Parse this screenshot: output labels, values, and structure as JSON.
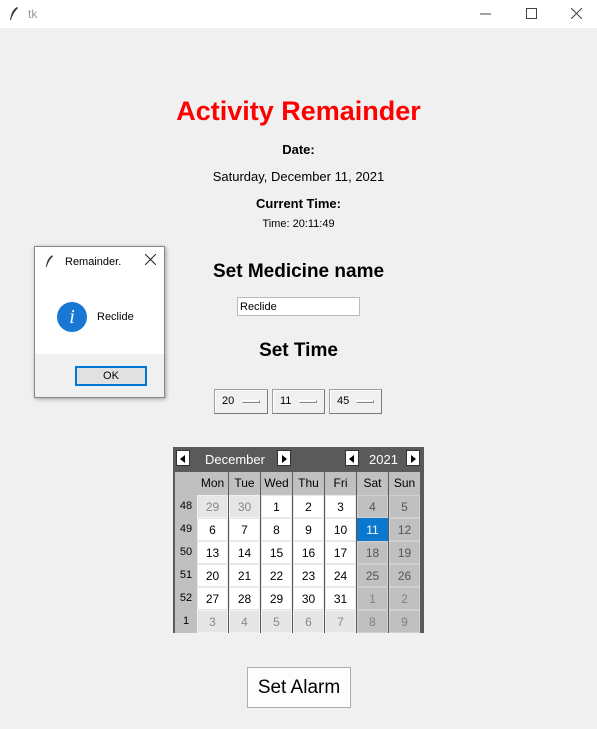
{
  "window": {
    "title": "tk"
  },
  "app": {
    "title": "Activity Remainder",
    "date_label": "Date:",
    "date_value": "Saturday, December 11, 2021",
    "current_time_label": "Current Time:",
    "current_time_value": "Time: 20:11:49",
    "medicine_label": "Set Medicine name",
    "medicine_input_value": "Reclide",
    "time_label": "Set Time",
    "hour": "20",
    "minute": "11",
    "second": "45",
    "alarm_button": "Set Alarm"
  },
  "calendar": {
    "month": "December",
    "year": "2021",
    "weekday_headers": [
      "Mon",
      "Tue",
      "Wed",
      "Thu",
      "Fri",
      "Sat",
      "Sun"
    ],
    "weeks": [
      {
        "week": "48",
        "days": [
          "29",
          "30",
          "1",
          "2",
          "3",
          "4",
          "5"
        ]
      },
      {
        "week": "49",
        "days": [
          "6",
          "7",
          "8",
          "9",
          "10",
          "11",
          "12"
        ]
      },
      {
        "week": "50",
        "days": [
          "13",
          "14",
          "15",
          "16",
          "17",
          "18",
          "19"
        ]
      },
      {
        "week": "51",
        "days": [
          "20",
          "21",
          "22",
          "23",
          "24",
          "25",
          "26"
        ]
      },
      {
        "week": "52",
        "days": [
          "27",
          "28",
          "29",
          "30",
          "31",
          "1",
          "2"
        ]
      },
      {
        "week": "1",
        "days": [
          "3",
          "4",
          "5",
          "6",
          "7",
          "8",
          "9"
        ]
      }
    ],
    "selected_day": "11",
    "selected_color": "#0b78d0"
  },
  "dialog": {
    "title": "Remainder.",
    "message": "Reclide",
    "ok_label": "OK",
    "icon": "info-icon"
  },
  "colors": {
    "title": "#ff0000",
    "background": "#f0f0f0"
  }
}
